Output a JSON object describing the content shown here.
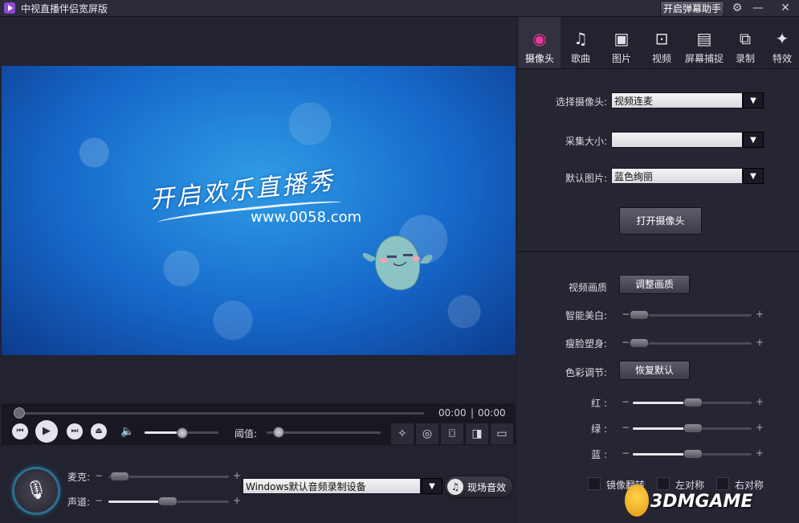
{
  "window": {
    "title": "中视直播伴侣宽屏版",
    "danmu_button": "开启弹幕助手"
  },
  "preview": {
    "slogan": "开启欢乐直播秀",
    "website": "www.0058.com"
  },
  "player": {
    "time_current": "00:00",
    "time_separator": "|",
    "time_total": "00:00",
    "threshold_label": "阈值:"
  },
  "audio": {
    "mic_label": "麦克:",
    "channel_label": "声道:",
    "minus": "−",
    "plus": "+",
    "device": "Windows默认音频录制设备",
    "live_sound_button": "现场音效"
  },
  "tabs": [
    {
      "label": "摄像头",
      "icon": "webcam-icon",
      "glyph": "◉"
    },
    {
      "label": "歌曲",
      "icon": "music-note-icon",
      "glyph": "♫"
    },
    {
      "label": "图片",
      "icon": "picture-icon",
      "glyph": "▣"
    },
    {
      "label": "视频",
      "icon": "video-camera-icon",
      "glyph": "⊡"
    },
    {
      "label": "屏幕捕捉",
      "icon": "film-strip-icon",
      "glyph": "▤"
    },
    {
      "label": "录制",
      "icon": "record-frame-icon",
      "glyph": "⧉"
    },
    {
      "label": "特效",
      "icon": "magic-wand-icon",
      "glyph": "✦"
    }
  ],
  "camera": {
    "select_label": "选择摄像头:",
    "select_value": "视频连麦",
    "size_label": "采集大小:",
    "size_value": "",
    "default_pic_label": "默认图片:",
    "default_pic_value": "蓝色绚丽",
    "open_button": "打开摄像头"
  },
  "adjust": {
    "quality_label": "视频画质",
    "quality_button": "调整画质",
    "beauty_label": "智能美白:",
    "beauty_level": 0.05,
    "slim_label": "瘦脸塑身:",
    "slim_level": 0.05,
    "color_label": "色彩调节:",
    "reset_button": "恢复默认",
    "red_label": "红 :",
    "red_level": 0.5,
    "green_label": "绿 :",
    "green_level": 0.5,
    "blue_label": "蓝 :",
    "blue_level": 0.5,
    "minus": "−",
    "plus": "+",
    "mirror_label": "镜像翻转",
    "left_sym_label": "左对称",
    "right_sym_label": "右对称"
  },
  "watermark": {
    "text": "3DMGAME"
  },
  "colors": {
    "accent": "#e9389a",
    "panel": "#262532",
    "video_blue": "#1668c9"
  }
}
